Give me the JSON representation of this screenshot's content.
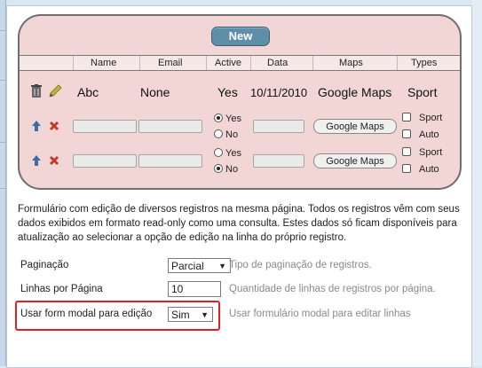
{
  "new_button": "New",
  "columns": [
    "Name",
    "Email",
    "Active",
    "Data",
    "Maps",
    "Types"
  ],
  "view_row": {
    "name": "Abc",
    "email": "None",
    "active": "Yes",
    "data": "10/11/2010",
    "maps": "Google Maps",
    "types": "Sport"
  },
  "edit_rows": [
    {
      "radio_yes": "Yes",
      "radio_no": "No",
      "selected": "Yes",
      "maps_button": "Google Maps",
      "check1": "Sport",
      "check2": "Auto"
    },
    {
      "radio_yes": "Yes",
      "radio_no": "No",
      "selected": "No",
      "maps_button": "Google Maps",
      "check1": "Sport",
      "check2": "Auto"
    }
  ],
  "description": "Formulário com edição de diversos registros na mesma página. Todos os registros vêm com seus dados exibidos em formato read-only como uma consulta. Estes dados só ficam disponíveis para atualização ao selecionar a opção de edição na linha do próprio registro.",
  "settings": {
    "pagination": {
      "label": "Paginação",
      "value": "Parcial",
      "hint": "Tipo de paginação de registros."
    },
    "rows_per_page": {
      "label": "Linhas por Página",
      "value": "10",
      "hint": "Quantidade de linhas de registros por página."
    },
    "modal_form": {
      "label": "Usar form modal para edição",
      "value": "Sim",
      "hint": "Usar formulário modal para editar linhas"
    }
  },
  "colors": {
    "panel_bg": "#f2d5d5",
    "new_button_bg": "#5f8fa8",
    "highlight_border": "#e02020",
    "arrow_blue": "#3a6ea5",
    "delete_red": "#c0392b"
  },
  "icons": {
    "delete": "trash-icon",
    "edit": "pencil-icon",
    "move_up": "arrow-up-icon",
    "remove": "x-icon",
    "dropdown": "caret-down-icon"
  }
}
